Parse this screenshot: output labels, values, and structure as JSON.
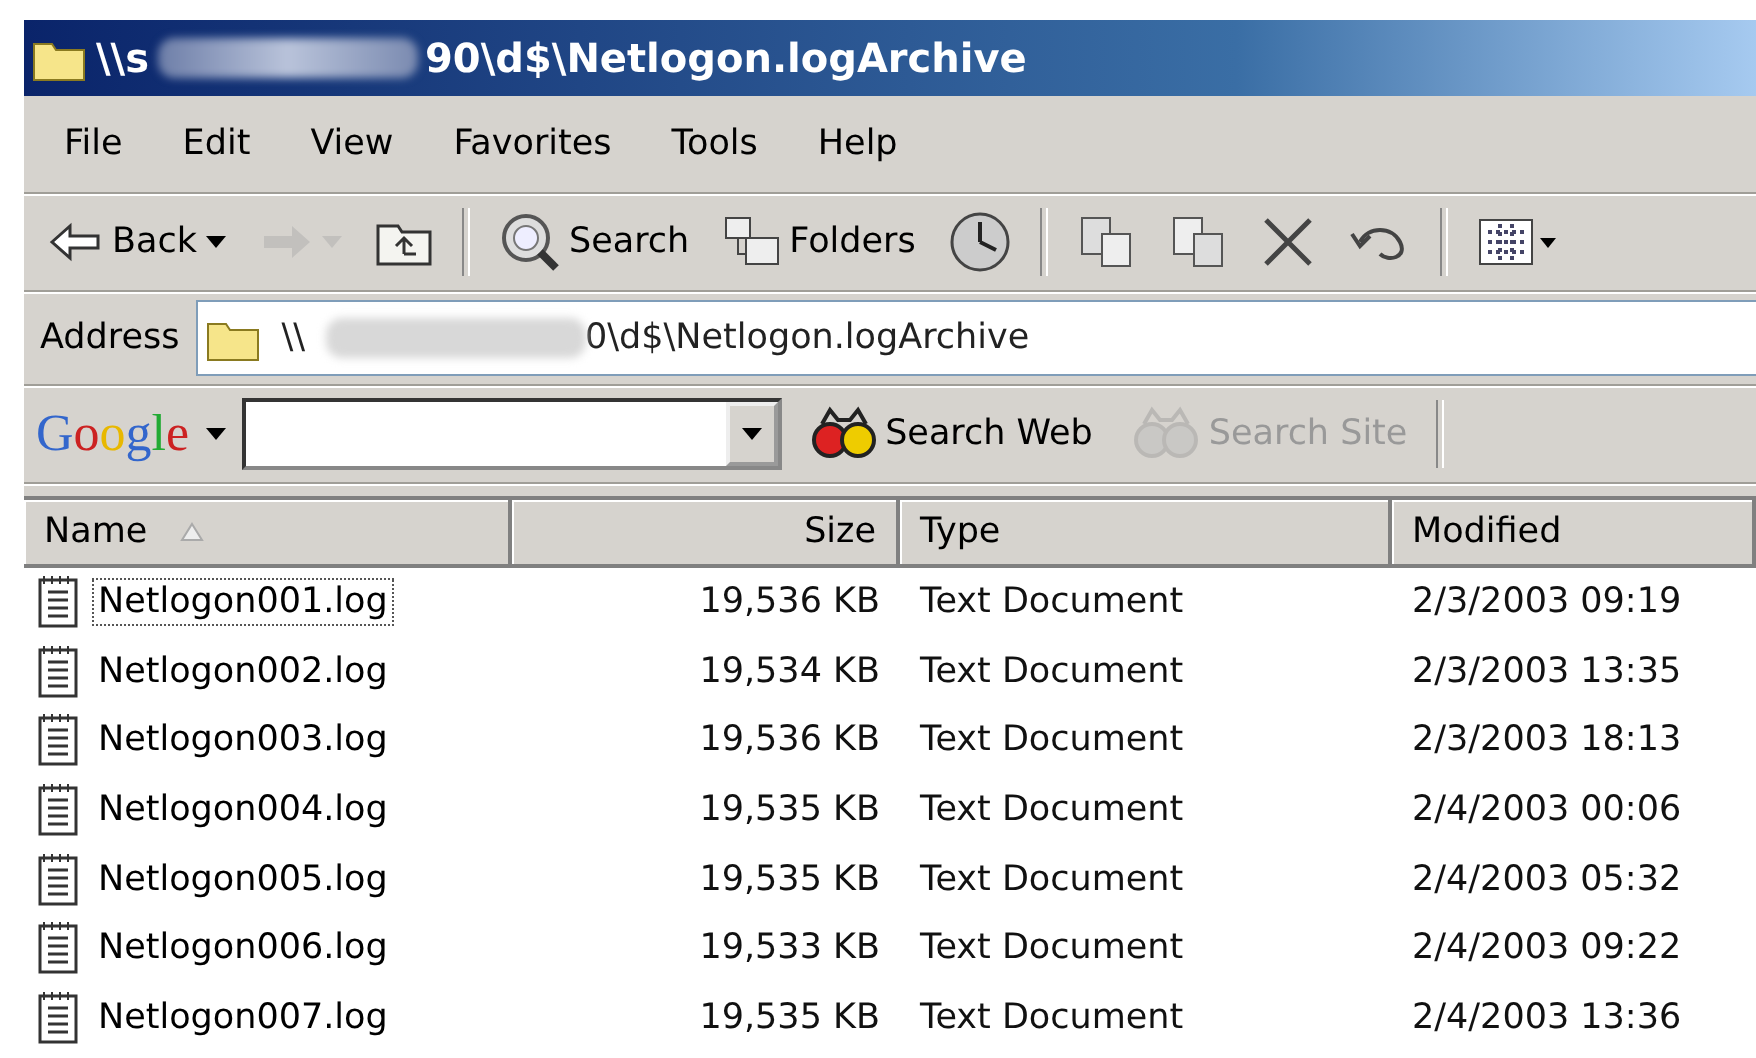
{
  "window": {
    "title_start": "\\\\s",
    "title_end": "90\\d$\\Netlogon.logArchive"
  },
  "menu": [
    "File",
    "Edit",
    "View",
    "Favorites",
    "Tools",
    "Help"
  ],
  "toolbar": [
    {
      "kind": "back",
      "label": "Back",
      "disabled": false
    },
    {
      "kind": "forward",
      "disabled": true
    },
    {
      "kind": "up",
      "disabled": false
    },
    {
      "kind": "search",
      "label": "Search",
      "disabled": false
    },
    {
      "kind": "folders",
      "label": "Folders",
      "disabled": false
    },
    {
      "kind": "history",
      "disabled": false
    },
    {
      "kind": "moveto",
      "disabled": false
    },
    {
      "kind": "copyto",
      "disabled": false
    },
    {
      "kind": "delete",
      "disabled": false
    },
    {
      "kind": "undo",
      "disabled": false
    },
    {
      "kind": "views",
      "disabled": false
    }
  ],
  "address": {
    "label": "Address",
    "value_start": "\\\\",
    "value_end": "0\\d$\\Netlogon.logArchive"
  },
  "google": {
    "logo": "Google",
    "buttons": [
      {
        "label": "Search Web",
        "disabled": false
      },
      {
        "label": "Search Site",
        "disabled": true
      }
    ]
  },
  "table": {
    "columns": [
      {
        "label": "Name",
        "sorted": true
      },
      {
        "label": "Size",
        "sorted": false
      },
      {
        "label": "Type",
        "sorted": false
      },
      {
        "label": "Modified",
        "sorted": false
      }
    ],
    "rows": [
      {
        "name": "Netlogon001.log",
        "size": "19,536 KB",
        "type": "Text Document",
        "modified": "2/3/2003 09:19",
        "focused": true
      },
      {
        "name": "Netlogon002.log",
        "size": "19,534 KB",
        "type": "Text Document",
        "modified": "2/3/2003 13:35",
        "focused": false
      },
      {
        "name": "Netlogon003.log",
        "size": "19,536 KB",
        "type": "Text Document",
        "modified": "2/3/2003 18:13",
        "focused": false
      },
      {
        "name": "Netlogon004.log",
        "size": "19,535 KB",
        "type": "Text Document",
        "modified": "2/4/2003 00:06",
        "focused": false
      },
      {
        "name": "Netlogon005.log",
        "size": "19,535 KB",
        "type": "Text Document",
        "modified": "2/4/2003 05:32",
        "focused": false
      },
      {
        "name": "Netlogon006.log",
        "size": "19,533 KB",
        "type": "Text Document",
        "modified": "2/4/2003 09:22",
        "focused": false
      },
      {
        "name": "Netlogon007.log",
        "size": "19,535 KB",
        "type": "Text Document",
        "modified": "2/4/2003 13:36",
        "focused": false
      }
    ]
  }
}
